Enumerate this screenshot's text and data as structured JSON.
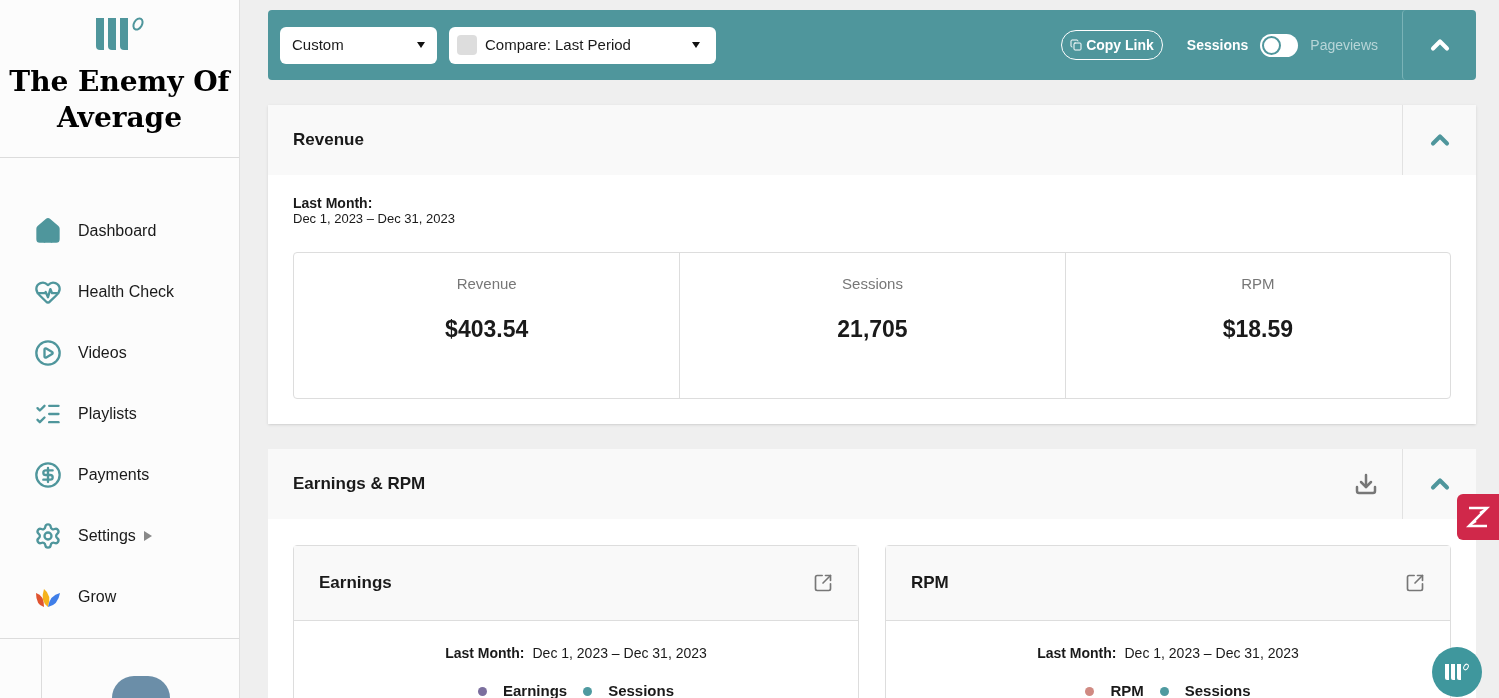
{
  "sidebar": {
    "site_title": "The Enemy Of Average",
    "items": [
      {
        "kind": "home",
        "label": "Dashboard",
        "has_submenu": false
      },
      {
        "kind": "health",
        "label": "Health Check",
        "has_submenu": false
      },
      {
        "kind": "video",
        "label": "Videos",
        "has_submenu": false
      },
      {
        "kind": "playlist",
        "label": "Playlists",
        "has_submenu": false
      },
      {
        "kind": "payment",
        "label": "Payments",
        "has_submenu": false
      },
      {
        "kind": "settings",
        "label": "Settings",
        "has_submenu": true
      },
      {
        "kind": "grow",
        "label": "Grow",
        "has_submenu": false
      }
    ]
  },
  "toolbar": {
    "range_select": "Custom",
    "compare_select": "Compare: Last Period",
    "compare_checked": false,
    "copy_link": "Copy Link",
    "toggle": {
      "left_label": "Sessions",
      "right_label": "Pageviews",
      "on": false
    }
  },
  "revenue": {
    "title": "Revenue",
    "period_label": "Last Month:",
    "period_range": "Dec 1, 2023 – Dec 31, 2023",
    "stats": [
      {
        "label": "Revenue",
        "value": "$403.54"
      },
      {
        "label": "Sessions",
        "value": "21,705"
      },
      {
        "label": "RPM",
        "value": "$18.59"
      }
    ]
  },
  "earnings_rpm": {
    "title": "Earnings & RPM",
    "cards": [
      {
        "title": "Earnings",
        "period_label": "Last Month:",
        "period_range": "Dec 1, 2023 – Dec 31, 2023",
        "legend": [
          {
            "label": "Earnings",
            "color": "#7b6f9e"
          },
          {
            "label": "Sessions",
            "color": "#4e9aa0"
          }
        ]
      },
      {
        "title": "RPM",
        "period_label": "Last Month:",
        "period_range": "Dec 1, 2023 – Dec 31, 2023",
        "legend": [
          {
            "label": "RPM",
            "color": "#d08a82"
          },
          {
            "label": "Sessions",
            "color": "#4e9aa0"
          }
        ]
      }
    ]
  }
}
